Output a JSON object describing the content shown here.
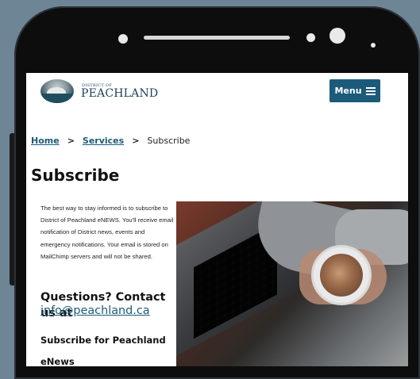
{
  "site": {
    "logo_small": "DISTRICT OF",
    "logo_big": "PEACHLAND",
    "menu_label": "Menu"
  },
  "breadcrumb": {
    "home": "Home",
    "sep1": ">",
    "services": "Services",
    "sep2": ">",
    "current": "Subscribe"
  },
  "page": {
    "title": "Subscribe",
    "intro": "The best way to stay informed is to subscribe to District of Peachland eNEWS. You'll receive email notification of District news, events and emergency notifications. Your email is stored on MailChimp servers and will not be shared.",
    "questions": "Questions? Contact us at",
    "email": "info@peachland.ca",
    "subscribe_heading": "Subscribe for Peachland eNews"
  },
  "colors": {
    "accent": "#1c5a7a",
    "background": "#6e8595"
  }
}
